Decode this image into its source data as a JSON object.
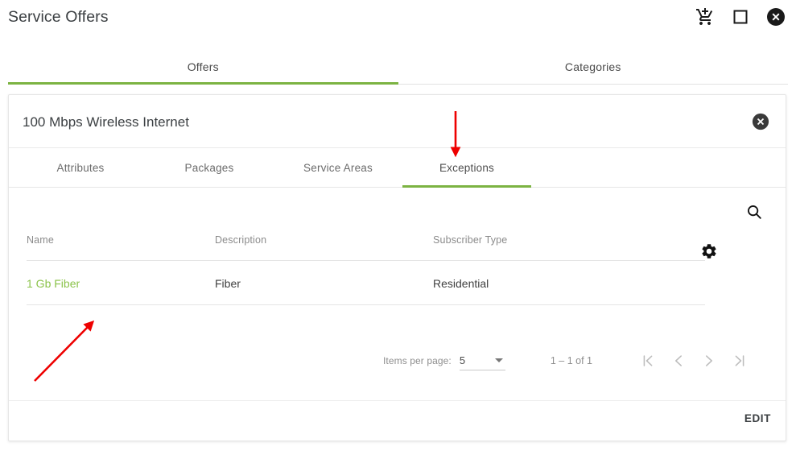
{
  "header": {
    "title": "Service Offers",
    "icons": [
      {
        "name": "add-shopping-cart-icon",
        "glyph": "cart"
      },
      {
        "name": "maximize-window-icon",
        "glyph": "square"
      },
      {
        "name": "close-window-icon",
        "glyph": "close-circle"
      }
    ]
  },
  "outer_tabs": [
    {
      "label": "Offers",
      "active": true
    },
    {
      "label": "Categories",
      "active": false
    }
  ],
  "card": {
    "title": "100 Mbps Wireless Internet",
    "close_icon": "close-circle-icon",
    "inner_tabs": [
      {
        "label": "Attributes",
        "active": false
      },
      {
        "label": "Packages",
        "active": false
      },
      {
        "label": "Service Areas",
        "active": false
      },
      {
        "label": "Exceptions",
        "active": true
      }
    ],
    "toolbar": {
      "search_icon": "search-icon",
      "settings_icon": "gear-icon"
    },
    "table": {
      "columns": [
        "Name",
        "Description",
        "Subscriber Type"
      ],
      "rows": [
        {
          "name": "1 Gb Fiber",
          "description": "Fiber",
          "subscriber_type": "Residential"
        }
      ]
    },
    "paginator": {
      "items_per_page_label": "Items per page:",
      "items_per_page_value": "5",
      "range_label": "1 – 1 of 1",
      "buttons": [
        {
          "name": "first-page-button",
          "glyph": "|<"
        },
        {
          "name": "previous-page-button",
          "glyph": "<"
        },
        {
          "name": "next-page-button",
          "glyph": ">"
        },
        {
          "name": "last-page-button",
          "glyph": ">|"
        }
      ]
    },
    "footer": {
      "edit_label": "EDIT"
    }
  },
  "annotations": {
    "color": "#ee0000",
    "arrows": [
      {
        "name": "arrow-to-exceptions-tab",
        "target": "Exceptions tab"
      },
      {
        "name": "arrow-to-offer-name-link",
        "target": "1 Gb Fiber link"
      }
    ]
  },
  "colors": {
    "accent_green": "#7cb342",
    "link_green": "#8bc34a",
    "annotation_red": "#ee0000"
  }
}
